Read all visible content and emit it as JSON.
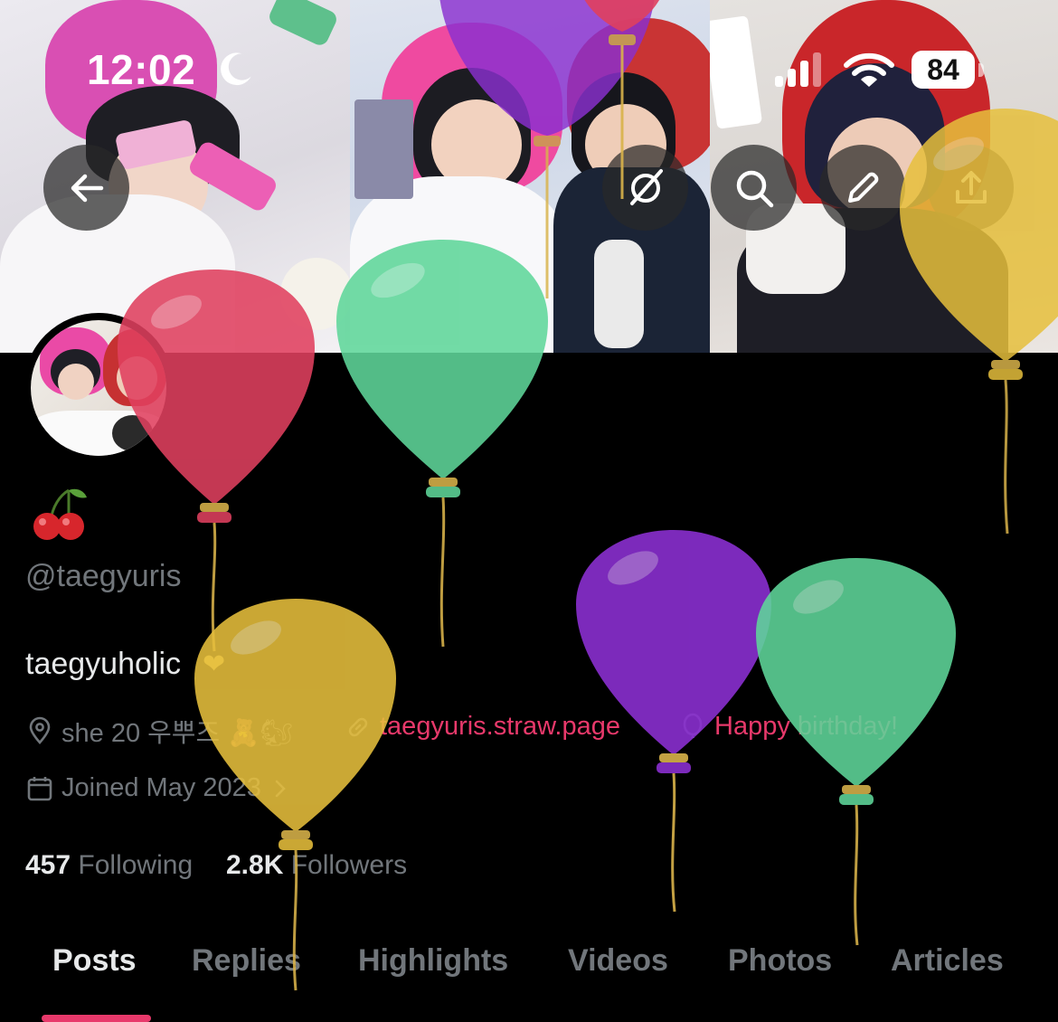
{
  "status_bar": {
    "time": "12:02",
    "battery": "84",
    "icons": [
      "moon-icon",
      "signal-icon",
      "wifi-icon",
      "battery-icon"
    ]
  },
  "header": {
    "buttons": [
      {
        "name": "back-arrow-icon"
      },
      {
        "name": "grok-icon"
      },
      {
        "name": "search-icon"
      },
      {
        "name": "edit-pencil-icon"
      },
      {
        "name": "share-icon"
      }
    ]
  },
  "profile": {
    "display_name_emoji": "🍒",
    "handle": "@taegyuris",
    "bio": "taegyuholic",
    "bio_heart": "❤",
    "location": "she 20 우뿌즈 🧸🐿",
    "website": "taegyuris.straw.page",
    "birthday": "Happy birthday!",
    "joined": "Joined May 2023",
    "following_count": "457",
    "following_label": "Following",
    "followers_count": "2.8K",
    "followers_label": "Followers"
  },
  "tabs": [
    {
      "label": "Posts",
      "active": true
    },
    {
      "label": "Replies",
      "active": false
    },
    {
      "label": "Highlights",
      "active": false
    },
    {
      "label": "Videos",
      "active": false
    },
    {
      "label": "Photos",
      "active": false
    },
    {
      "label": "Articles",
      "active": false
    }
  ],
  "colors": {
    "accent": "#e8396b",
    "muted": "#71767b",
    "text": "#e7e9ea",
    "background": "#000000",
    "balloon_red": "#e0405f",
    "balloon_green": "#5fd69a",
    "balloon_yellow": "#e6bf3c",
    "balloon_purple": "#8a2fd0"
  }
}
